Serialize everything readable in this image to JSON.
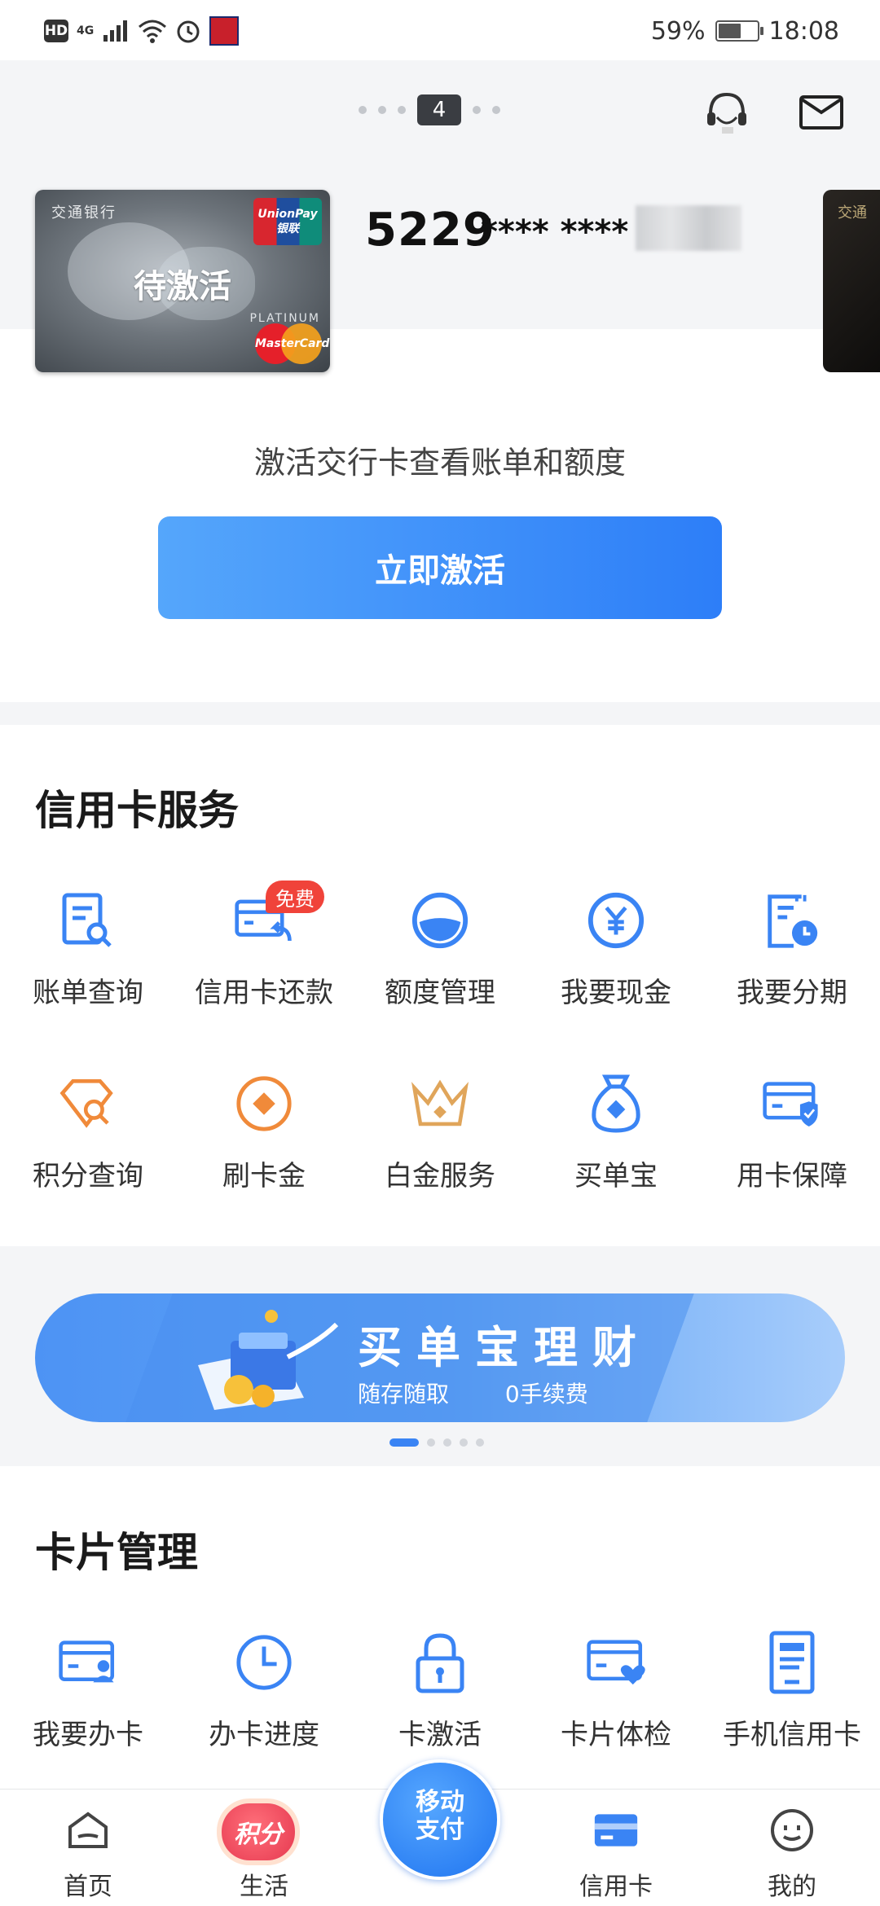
{
  "status_bar": {
    "hd": "HD",
    "network": "4G",
    "battery": "59%",
    "battery_level": 0.59,
    "time": "18:08"
  },
  "pager": {
    "current": "4"
  },
  "card": {
    "bank_name": "交通银行",
    "brand": "UnionPay",
    "brand_cn": "银联",
    "status": "待激活",
    "tier": "PLATINUM",
    "network": "MasterCard",
    "number_prefix": "5229",
    "number_mask": "**** ****",
    "next_card_bank": "交通"
  },
  "activation": {
    "message": "激活交行卡查看账单和额度",
    "button": "立即激活"
  },
  "credit_services": {
    "title": "信用卡服务",
    "free_badge": "免费",
    "items": [
      {
        "label": "账单查询",
        "icon": "bill-search-icon"
      },
      {
        "label": "信用卡还款",
        "icon": "card-repay-icon"
      },
      {
        "label": "额度管理",
        "icon": "limit-management-icon"
      },
      {
        "label": "我要现金",
        "icon": "yuan-coin-icon"
      },
      {
        "label": "我要分期",
        "icon": "installment-clock-icon"
      },
      {
        "label": "积分查询",
        "icon": "points-search-icon"
      },
      {
        "label": "刷卡金",
        "icon": "cashback-icon"
      },
      {
        "label": "白金服务",
        "icon": "crown-icon"
      },
      {
        "label": "买单宝",
        "icon": "money-bag-icon"
      },
      {
        "label": "用卡保障",
        "icon": "card-shield-icon"
      }
    ]
  },
  "banner": {
    "title": "买单宝理财",
    "sub_left": "随存随取",
    "sub_right": "0手续费"
  },
  "card_management": {
    "title": "卡片管理",
    "items": [
      {
        "label": "我要办卡",
        "icon": "card-user-icon"
      },
      {
        "label": "办卡进度",
        "icon": "clock-icon"
      },
      {
        "label": "卡激活",
        "icon": "lock-icon"
      },
      {
        "label": "卡片体检",
        "icon": "card-heart-icon"
      },
      {
        "label": "手机信用卡",
        "icon": "phone-card-icon"
      }
    ]
  },
  "bottom_nav": {
    "home": "首页",
    "life": "生活",
    "points_badge": "积分",
    "center_line1": "移动",
    "center_line2": "支付",
    "credit_card": "信用卡",
    "mine": "我的"
  },
  "colors": {
    "primary_blue": "#3a84f4",
    "orange": "#f08a3a",
    "badge_red": "#f0433a"
  }
}
